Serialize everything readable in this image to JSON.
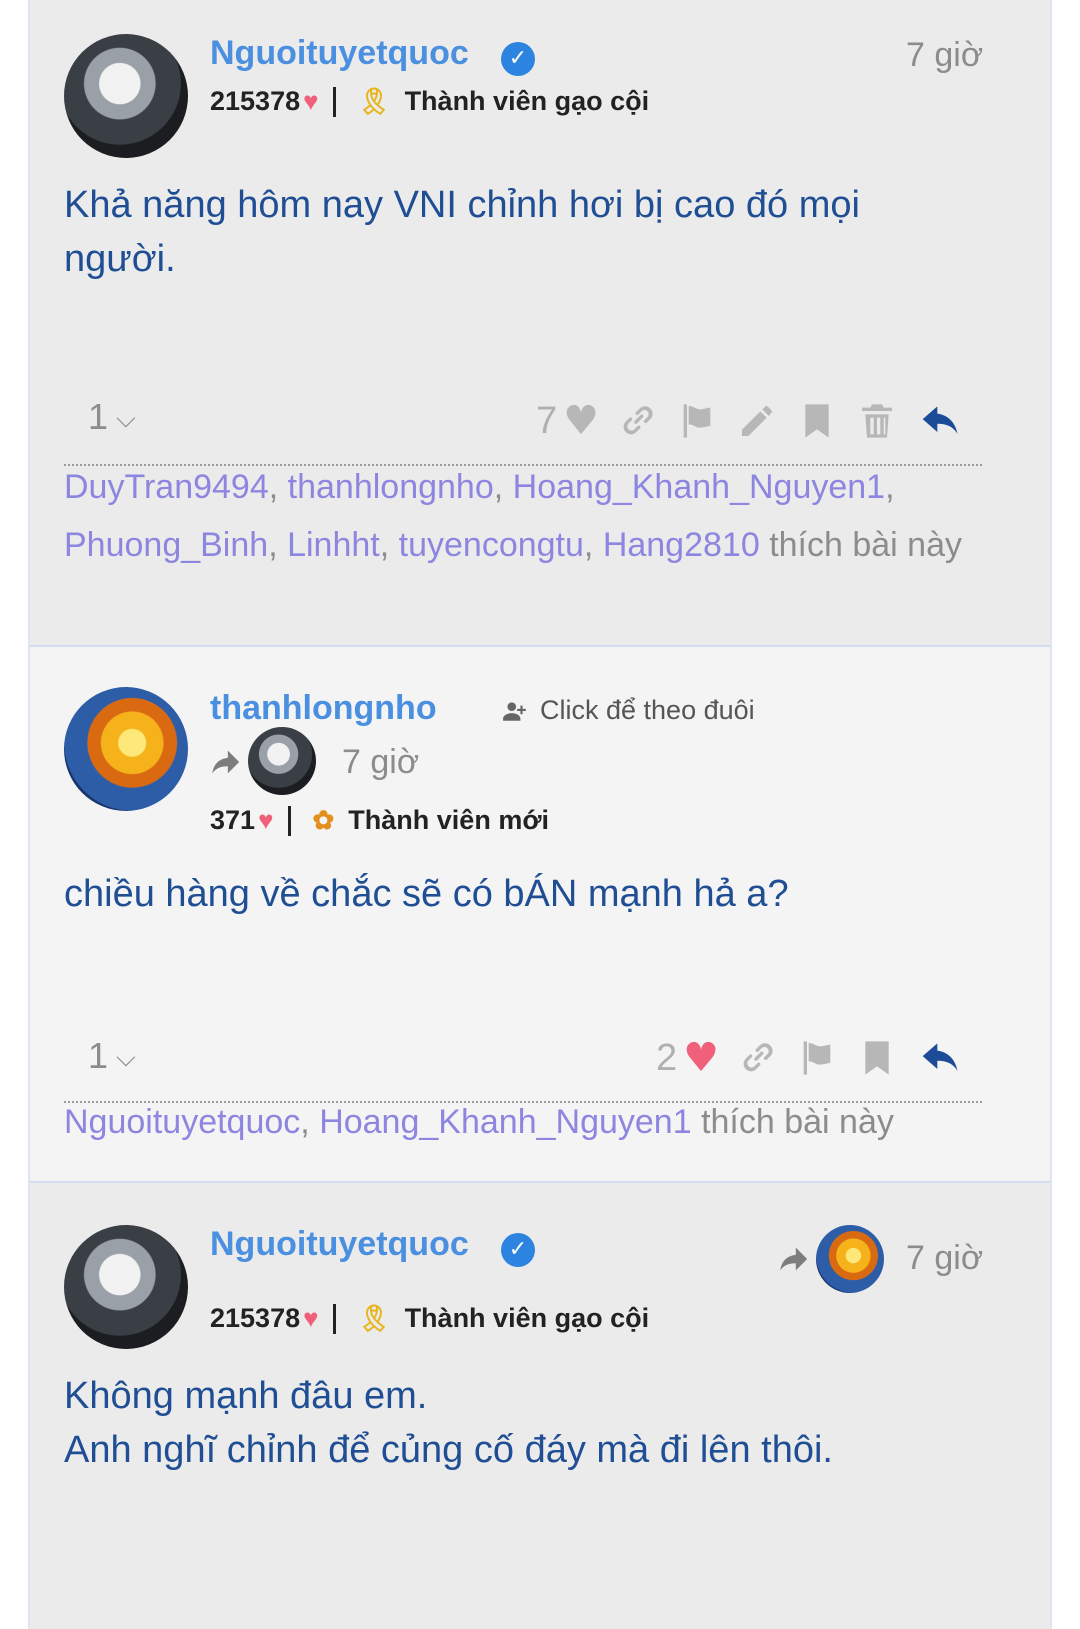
{
  "posts": [
    {
      "username": "Nguoituyetquoc",
      "verified": true,
      "time": "7 giờ",
      "points": "215378",
      "rank": "Thành viên gạo cội",
      "body": "Khả năng hôm nay VNI chỉnh hơi bị cao đó mọi\nngười.",
      "reply_count": "1",
      "like_count": "7",
      "likers": [
        "DuyTran9494",
        "thanhlongnho",
        "Hoang_Khanh_Nguyen1",
        "Phuong_Binh",
        "Linhht",
        "tuyencongtu",
        "Hang2810"
      ],
      "likers_suffix": "thích bài này"
    },
    {
      "username": "thanhlongnho",
      "follow_label": "Click để theo đuôi",
      "time": "7 giờ",
      "points": "371",
      "rank": "Thành viên mới",
      "body": "chiều hàng về chắc sẽ có bÁN mạnh hả a?",
      "reply_count": "1",
      "like_count": "2",
      "likers": [
        "Nguoituyetquoc",
        "Hoang_Khanh_Nguyen1"
      ],
      "likers_suffix": "thích bài này"
    },
    {
      "username": "Nguoituyetquoc",
      "verified": true,
      "time": "7 giờ",
      "points": "215378",
      "rank": "Thành viên gạo cội",
      "body": "Không mạnh đâu em.\nAnh nghĩ chỉnh để củng cố đáy mà đi lên thôi."
    }
  ],
  "icons": {
    "verified": "check-badge-icon",
    "heart": "heart-icon",
    "medal": "medal-icon",
    "new_member": "sprout-icon",
    "link": "link-icon",
    "flag": "flag-icon",
    "edit": "pencil-icon",
    "bookmark": "bookmark-icon",
    "delete": "trash-icon",
    "reply": "reply-icon",
    "share": "share-arrow-icon",
    "follow": "add-user-icon",
    "chevron": "chevron-down-icon"
  },
  "colors": {
    "username": "#4a8fe0",
    "body_text": "#1f4e94",
    "liker": "#8d86e0",
    "heart": "#f0607a",
    "reply": "#1c4c97"
  }
}
